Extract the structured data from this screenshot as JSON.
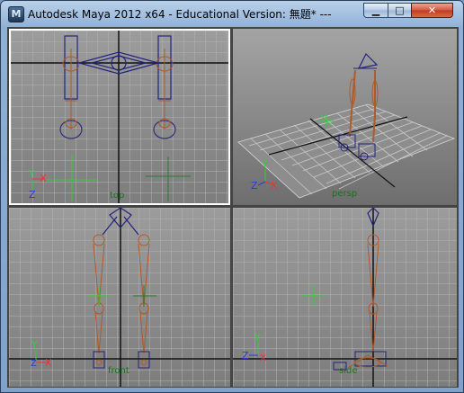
{
  "window": {
    "title": "Autodesk Maya 2012 x64 - Educational Version: 無題*    ---",
    "app_icon_glyph": "M",
    "controls": {
      "minimize": "▁",
      "maximize": "□",
      "close": "✕"
    }
  },
  "viewports": {
    "top": {
      "camera_label": "top",
      "axis_y": "Y",
      "axis_x": "X",
      "axis_z": "Z"
    },
    "persp": {
      "camera_label": "persp",
      "axis_y": "Y",
      "axis_x": "X",
      "axis_z": "Z"
    },
    "front": {
      "camera_label": "front",
      "axis_y": "Y",
      "axis_x": "X",
      "axis_z": "Z"
    },
    "side": {
      "camera_label": "side",
      "axis_y": "Y",
      "axis_x": "X",
      "axis_z": "Z"
    }
  },
  "colors": {
    "viewport_bg_top": "#9c9c9c",
    "viewport_bg_bottom": "#7d7d7d",
    "grid": "#b3b3b3",
    "grid_axis": "#111111",
    "joint": "#b05a2a",
    "ik_handle": "#22237a",
    "locator": "#2fd13a",
    "active_border": "#ffffff"
  }
}
